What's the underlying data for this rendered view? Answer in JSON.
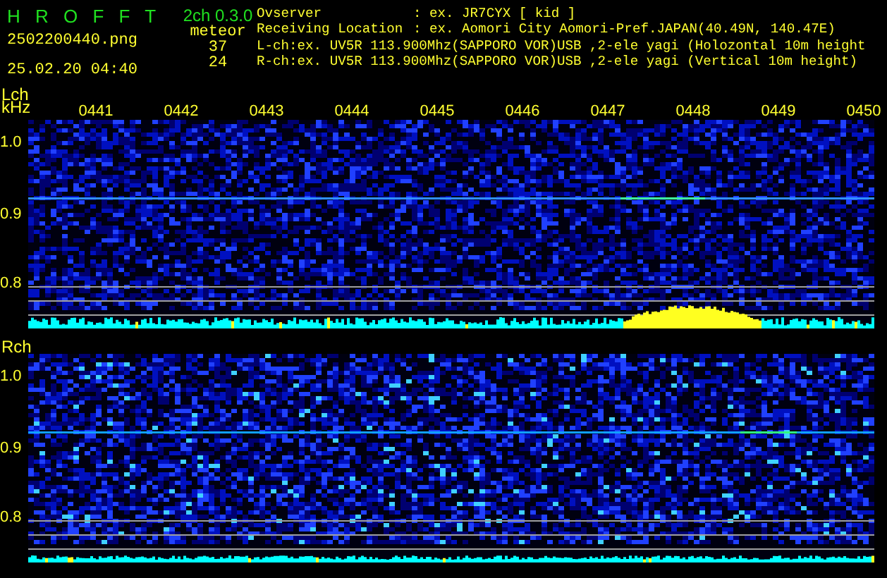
{
  "header": {
    "title": "H R O F F T",
    "version": "2ch 0.3.0",
    "filename": "2502200440.png",
    "datetime": "25.02.20 04:40",
    "meteor_label": "meteor",
    "counts": [
      "37",
      "24"
    ]
  },
  "info": [
    {
      "label": "Ovserver",
      "value": ": ex. JR7CYX [ kid ]"
    },
    {
      "label": "Receiving Location",
      "value": ": ex. Aomori City Aomori-Pref.JAPAN(40.49N, 140.47E)"
    },
    {
      "label": "L-ch:ex. UV5R 113.900Mhz(SAPPORO VOR)USB ,2-ele yagi (Holozontal 10m height"
    },
    {
      "label": "R-ch:ex. UV5R 113.900Mhz(SAPPORO VOR)USB ,2-ele yagi (Vertical 10m height)"
    }
  ],
  "channels": [
    {
      "label": "Lch",
      "unit": "kHz",
      "time_ticks": [
        "0441",
        "0442",
        "0443",
        "0444",
        "0445",
        "0446",
        "0447",
        "0448",
        "0449",
        "0450"
      ],
      "freq_ticks": [
        "1.0",
        "0.9",
        "0.8"
      ]
    },
    {
      "label": "Rch",
      "freq_ticks": [
        "1.0",
        "0.9",
        "0.8"
      ]
    }
  ]
}
